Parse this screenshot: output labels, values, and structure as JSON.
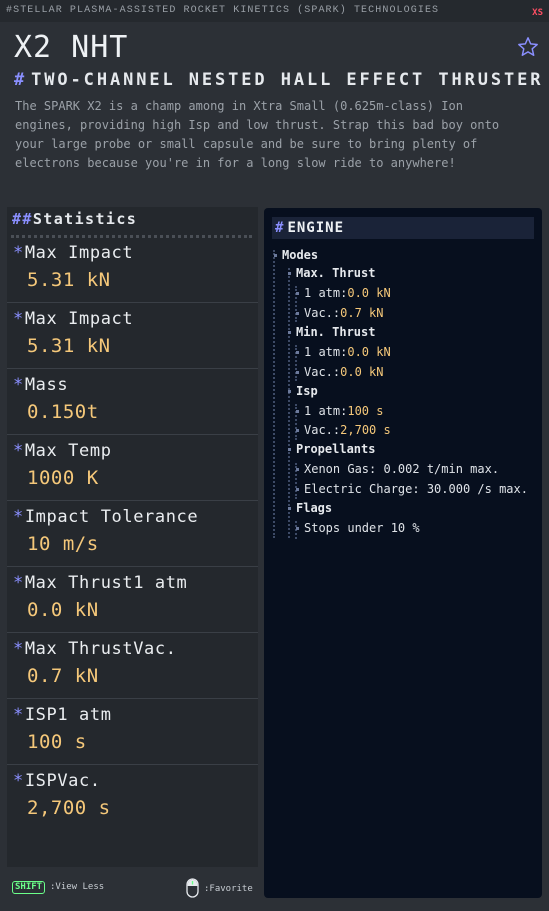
{
  "header": {
    "manufacturer": "#STELLAR PLASMA-ASSISTED ROCKET KINETICS (SPARK) TECHNOLOGIES",
    "size_tag": "XS",
    "part_name": "X2 NHT",
    "subtitle": "TWO-CHANNEL NESTED HALL EFFECT THRUSTER",
    "subtitle_hash": "#",
    "favorite_icon": "star-outline-icon",
    "description": "The SPARK X2 is a champ among in Xtra Small (0.625m-class) Ion\nengines, providing high Isp and low thrust. Strap this bad boy onto\nyour large probe or small capsule and be sure to bring plenty of\nelectrons because you're in for a long slow ride to anywhere!"
  },
  "stats": {
    "header_hashes": "##",
    "header": "Statistics",
    "bullet": "*",
    "items": [
      {
        "label": "Max Impact",
        "value": "5.31 kN"
      },
      {
        "label": "Max Impact",
        "value": "5.31 kN"
      },
      {
        "label": "Mass",
        "value": "0.150t"
      },
      {
        "label": "Max Temp",
        "value": "1000 K"
      },
      {
        "label": "Impact Tolerance",
        "value": "10 m/s"
      },
      {
        "label": "Max Thrust1 atm",
        "value": "0.0 kN"
      },
      {
        "label": "Max ThrustVac.",
        "value": "0.7 kN"
      },
      {
        "label": "ISP1 atm",
        "value": "100 s"
      },
      {
        "label": "ISPVac.",
        "value": "2,700 s"
      }
    ]
  },
  "engine": {
    "hash": "#",
    "header": "ENGINE",
    "modes_label": "Modes",
    "max_thrust_label": "Max. Thrust",
    "max_thrust_atm_label": "1 atm",
    "max_thrust_atm_value": "0.0 kN",
    "max_thrust_vac_label": "Vac.",
    "max_thrust_vac_value": "0.7 kN",
    "min_thrust_label": "Min. Thrust",
    "min_thrust_atm_label": "1 atm",
    "min_thrust_atm_value": "0.0 kN",
    "min_thrust_vac_label": "Vac.",
    "min_thrust_vac_value": "0.0 kN",
    "isp_label": "Isp",
    "isp_atm_label": "1 atm",
    "isp_atm_value": "100 s",
    "isp_vac_label": "Vac.",
    "isp_vac_value": "2,700 s",
    "propellants_label": "Propellants",
    "propellant_1": "Xenon Gas: 0.002 t/min max.",
    "propellant_2": "Electric Charge: 30.000 /s max.",
    "flags_label": "Flags",
    "flag_1": "Stops under 10 %"
  },
  "footer": {
    "shift_key": "SHIFT",
    "shift_action": ":View Less",
    "mouse_icon": "mouse-icon",
    "favorite_action": ":Favorite"
  },
  "colors": {
    "accent": "#8a8fff",
    "value": "#f5c87a",
    "size_tag": "#ff4e63",
    "key": "#6bff8a"
  }
}
